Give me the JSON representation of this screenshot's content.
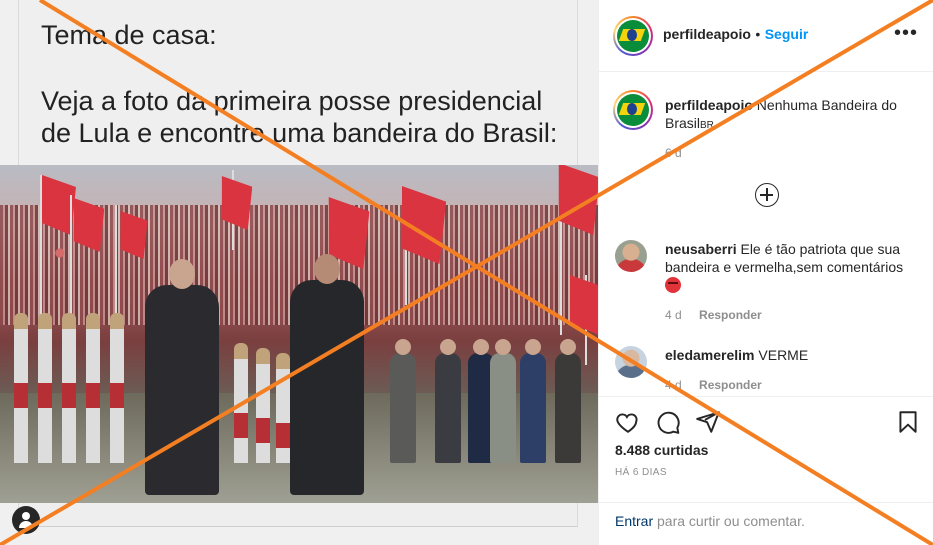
{
  "post": {
    "heading": "Tema de casa:",
    "body": "Veja a foto da primeira posse presidencial de Lula e encontre uma bandeira do Brasil:"
  },
  "header": {
    "username": "perfildeapoio",
    "separator": "•",
    "follow_label": "Seguir",
    "more_icon": "more-horizontal-icon"
  },
  "caption": {
    "username": "perfildeapoio",
    "text": "Nenhuma Bandeira do Brasil",
    "flag_suffix": "BR",
    "time": "6 d"
  },
  "load_more_icon": "plus-circle-icon",
  "comments": [
    {
      "username": "neusaberri",
      "text": "Ele é tão patriota que sua bandeira e vermelha,sem comentários",
      "emoji": "angry-face-emoji",
      "time": "4 d",
      "reply_label": "Responder"
    },
    {
      "username": "eledamerelim",
      "text": "VERME",
      "time": "4 d",
      "reply_label": "Responder"
    }
  ],
  "actions": {
    "icons": [
      "heart-icon",
      "comment-icon",
      "share-icon",
      "bookmark-icon"
    ],
    "likes": "8.488 curtidas",
    "date": "HÁ 6 DIAS"
  },
  "login": {
    "link": "Entrar",
    "text": " para curtir ou comentar."
  },
  "colors": {
    "accent": "#0095f6",
    "cross_overlay": "#f47f22",
    "flag_red": "#d93440"
  }
}
